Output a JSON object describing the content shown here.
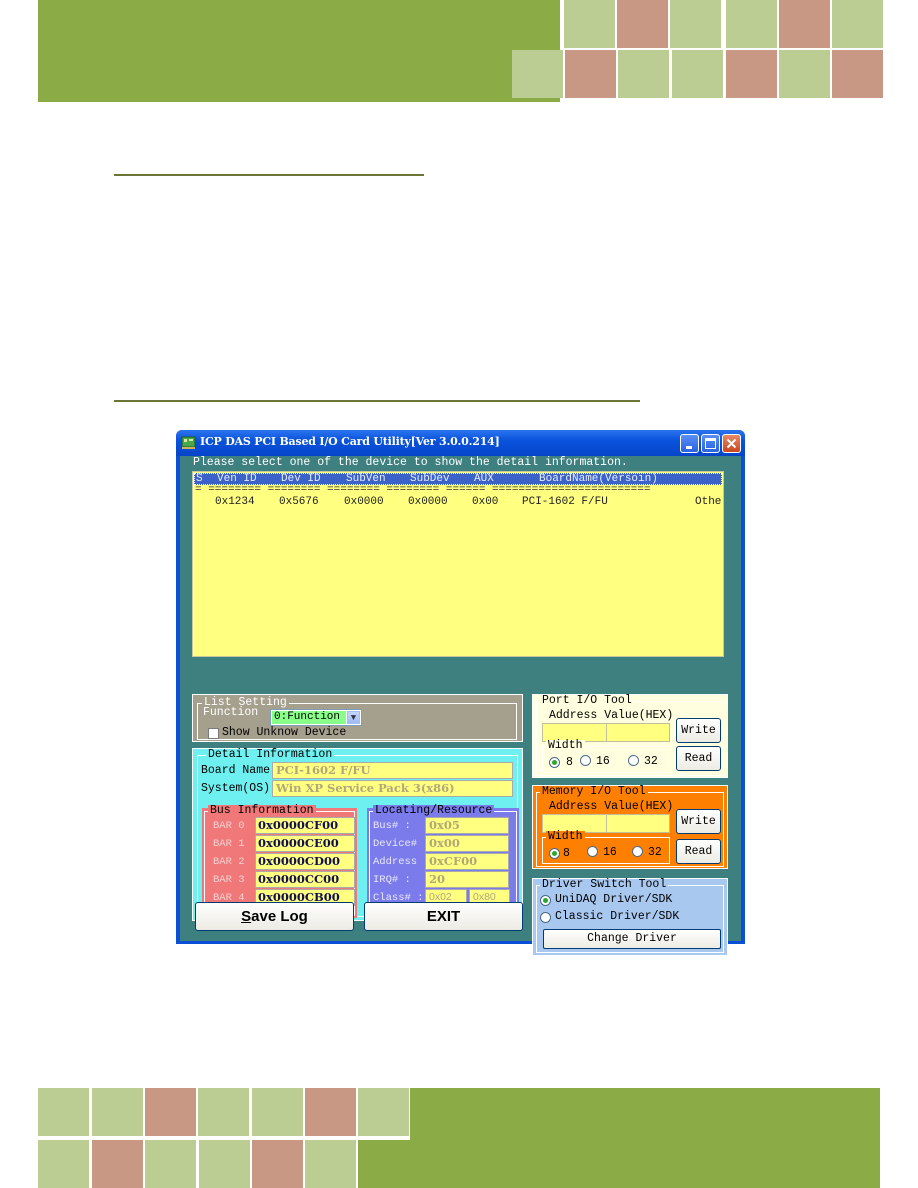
{
  "window": {
    "title": "ICP DAS PCI Based I/O Card Utility[Ver 3.0.0.214]",
    "controls": {
      "minimize": "_",
      "maximize": "□",
      "close": "✕"
    }
  },
  "prompt": "Please select one of the device to show the detail information.",
  "device_list": {
    "columns": [
      "S",
      "Ven ID",
      "Dev ID",
      "SubVen",
      "SubDev",
      "AUX",
      "BoardName(Versoin)"
    ],
    "separator": "= ======== ======== ======== ======== ====== ========================",
    "rows": [
      {
        "ven_id": "0x1234",
        "dev_id": "0x5676",
        "subven": "0x0000",
        "subdev": "0x0000",
        "aux": "0x00",
        "board": "PCI-1602 F/FU",
        "extra": "Othe"
      }
    ]
  },
  "list_setting": {
    "legend": "List Setting",
    "function_label": "Function",
    "function_value": "0:Function",
    "show_unknown_label": "Show Unknow Device",
    "show_unknown_checked": false
  },
  "detail_info": {
    "legend": "Detail Information",
    "board_name_label": "Board Name",
    "board_name_value": "PCI-1602 F/FU",
    "system_label": "System(OS)",
    "system_value": "Win XP Service Pack 3(x86)"
  },
  "bus_info": {
    "legend": "Bus Information",
    "bars": [
      {
        "label": "BAR 0",
        "value": "0x0000CF00"
      },
      {
        "label": "BAR 1",
        "value": "0x0000CE00"
      },
      {
        "label": "BAR 2",
        "value": "0x0000CD00"
      },
      {
        "label": "BAR 3",
        "value": "0x0000CC00"
      },
      {
        "label": "BAR 4",
        "value": "0x0000CB00"
      }
    ]
  },
  "locating": {
    "legend": "Locating/Resource",
    "bus_label": "Bus# :",
    "bus_value": "0x05",
    "device_label": "Device# :",
    "device_value": "0x00",
    "address_label": "Address :",
    "address_value": "0xCF00",
    "irq_label": "IRQ# :",
    "irq_value": "20",
    "class_label": "Class# :",
    "class_value1": "0x02",
    "class_value2": "0x80"
  },
  "buttons": {
    "save_log": "Save Log",
    "save_log_accel": "S",
    "exit": "EXIT"
  },
  "port_io": {
    "legend": "Port I/O Tool",
    "address_value_label": "Address Value(HEX)",
    "address": "",
    "value": "",
    "width_legend": "Width",
    "widths": [
      "8",
      "16",
      "32"
    ],
    "selected_width": "8",
    "write": "Write",
    "read": "Read"
  },
  "memory_io": {
    "legend": "Memory I/O Tool",
    "address_value_label": "Address Value(HEX)",
    "address": "",
    "value": "",
    "width_legend": "Width",
    "widths": [
      "8",
      "16",
      "32"
    ],
    "selected_width": "8",
    "write": "Write",
    "read": "Read"
  },
  "driver_switch": {
    "legend": "Driver Switch Tool",
    "options": [
      "UniDAQ Driver/SDK",
      "Classic Driver/SDK"
    ],
    "selected": "UniDAQ Driver/SDK",
    "change_button": "Change Driver"
  },
  "colors": {
    "accent_green": "#8aab45",
    "tile_green": "#bccd94",
    "tile_red": "#c99885",
    "list_bg": "#ffff80",
    "window_client": "#3e7f7f",
    "memory_io_bg": "#ff8000",
    "detail_bg": "#6ff0f0",
    "bus_bg": "#f07878",
    "locating_bg": "#7b7bec"
  }
}
